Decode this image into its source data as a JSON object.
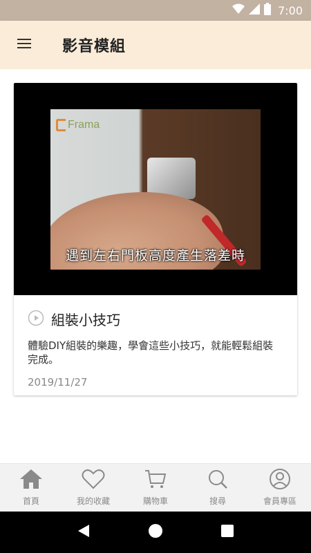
{
  "status_bar": {
    "time": "7:00"
  },
  "app_bar": {
    "title": "影音模組",
    "menu_icon": "hamburger-menu-icon"
  },
  "card": {
    "title": "組裝小技巧",
    "description": "體驗DIY組裝的樂趣，學會這些小技巧，就能輕鬆組裝完成。",
    "date": "2019/11/27",
    "video": {
      "brand": "Frama",
      "subtitle": "遇到左右門板高度產生落差時"
    }
  },
  "bottom_nav": {
    "items": [
      {
        "label": "首頁",
        "icon": "home-icon"
      },
      {
        "label": "我的收藏",
        "icon": "heart-icon"
      },
      {
        "label": "購物車",
        "icon": "cart-icon"
      },
      {
        "label": "搜尋",
        "icon": "search-icon"
      },
      {
        "label": "會員專區",
        "icon": "user-icon"
      }
    ]
  },
  "colors": {
    "status_bar": "#c2b2a2",
    "app_bar": "#fbecd9",
    "nav_icon": "#8a8a8a"
  }
}
